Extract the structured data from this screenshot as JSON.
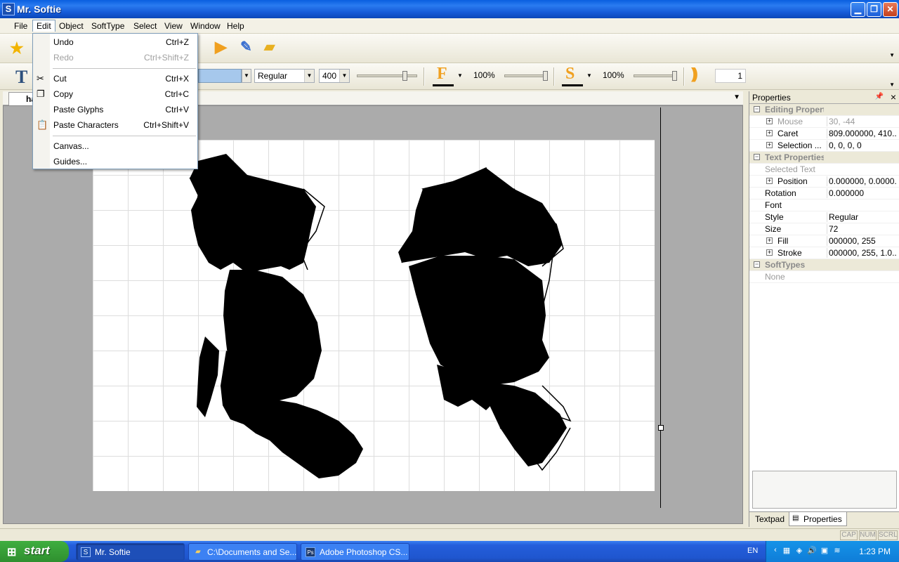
{
  "window": {
    "title": "Mr. Softie",
    "app_icon_letter": "S"
  },
  "menubar": {
    "items": [
      "File",
      "Edit",
      "Object",
      "SoftType",
      "Select",
      "View",
      "Window",
      "Help"
    ],
    "active": "Edit"
  },
  "edit_menu": {
    "items": [
      {
        "label": "Undo",
        "shortcut": "Ctrl+Z",
        "disabled": false
      },
      {
        "label": "Redo",
        "shortcut": "Ctrl+Shift+Z",
        "disabled": true
      },
      {
        "label": "Cut",
        "shortcut": "Ctrl+X",
        "disabled": false
      },
      {
        "label": "Copy",
        "shortcut": "Ctrl+C",
        "disabled": false
      },
      {
        "label": "Paste Glyphs",
        "shortcut": "Ctrl+V",
        "disabled": false
      },
      {
        "label": "Paste Characters",
        "shortcut": "Ctrl+Shift+V",
        "disabled": false
      },
      {
        "label": "Canvas...",
        "shortcut": "",
        "disabled": false
      },
      {
        "label": "Guides...",
        "shortcut": "",
        "disabled": false
      }
    ]
  },
  "text_toolbar": {
    "style_value": "Regular",
    "weight_value": "400",
    "fill_label": "F",
    "fill_opacity": "100%",
    "stroke_label": "S",
    "stroke_opacity": "100%",
    "stroke_width_value": "1"
  },
  "document": {
    "tab_label": "ha"
  },
  "properties": {
    "title": "Properties",
    "rows": [
      {
        "type": "cat",
        "key": "Editing Properties",
        "value": ""
      },
      {
        "type": "sub",
        "key": "Mouse",
        "value": "30, -44",
        "dim": true
      },
      {
        "type": "sub",
        "key": "Caret",
        "value": "809.000000, 410...."
      },
      {
        "type": "sub",
        "key": "Selection ...",
        "value": "0, 0, 0, 0"
      },
      {
        "type": "cat",
        "key": "Text Properties",
        "value": ""
      },
      {
        "type": "plain",
        "key": "Selected Text",
        "value": "",
        "dim": true
      },
      {
        "type": "sub",
        "key": "Position",
        "value": "0.000000, 0.0000..."
      },
      {
        "type": "plain",
        "key": "Rotation",
        "value": "0.000000"
      },
      {
        "type": "plain",
        "key": "Font",
        "value": ""
      },
      {
        "type": "plain",
        "key": "Style",
        "value": "Regular"
      },
      {
        "type": "plain",
        "key": "Size",
        "value": "72"
      },
      {
        "type": "sub",
        "key": "Fill",
        "value": "000000, 255"
      },
      {
        "type": "sub",
        "key": "Stroke",
        "value": "000000, 255, 1.0..."
      },
      {
        "type": "cat",
        "key": "SoftTypes",
        "value": ""
      },
      {
        "type": "plain",
        "key": "None",
        "value": "",
        "dim": true
      }
    ],
    "tabs": [
      "Textpad",
      "Properties"
    ],
    "active_tab": "Properties"
  },
  "statusbar": {
    "indicators": [
      "CAP",
      "NUM",
      "SCRL"
    ]
  },
  "taskbar": {
    "start_label": "start",
    "tasks": [
      {
        "label": "Mr. Softie",
        "icon": "S",
        "active": true
      },
      {
        "label": "C:\\Documents and Se...",
        "icon": "folder",
        "active": false
      },
      {
        "label": "Adobe Photoshop CS...",
        "icon": "Ps",
        "active": false
      }
    ],
    "lang": "EN",
    "clock": "1:23 PM"
  },
  "colors": {
    "titlebar": "#0a5fe0",
    "fill_accent": "#f0a020",
    "guide": "#000000"
  }
}
